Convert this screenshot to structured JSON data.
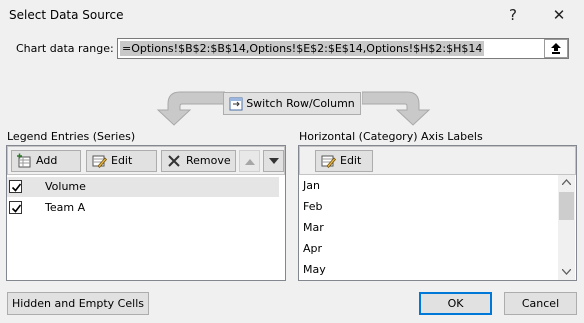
{
  "window": {
    "title": "Select Data Source",
    "help_glyph": "?",
    "close_glyph": "✕"
  },
  "range": {
    "label": "Chart data range:",
    "value": "=Options!$B$2:$B$14,Options!$E$2:$E$14,Options!$H$2:$H$14"
  },
  "switch_button": {
    "label": "Switch Row/Column"
  },
  "series_panel": {
    "heading": "Legend Entries (Series)",
    "add_label": "Add",
    "edit_label": "Edit",
    "remove_label": "Remove",
    "items": [
      {
        "label": "Volume",
        "checked": true,
        "selected": true
      },
      {
        "label": "Team A",
        "checked": true,
        "selected": false
      }
    ]
  },
  "category_panel": {
    "heading": "Horizontal (Category) Axis Labels",
    "edit_label": "Edit",
    "items": [
      "Jan",
      "Feb",
      "Mar",
      "Apr",
      "May"
    ]
  },
  "footer": {
    "hidden_empty_label": "Hidden and Empty Cells",
    "ok_label": "OK",
    "cancel_label": "Cancel"
  },
  "icons": [
    "help-icon",
    "close-icon",
    "collapse-range-icon",
    "switch-icon",
    "add-icon",
    "edit-icon",
    "remove-icon",
    "move-up-icon",
    "move-down-icon",
    "checkbox-checked-icon",
    "curved-arrow-left-icon",
    "curved-arrow-right-icon"
  ],
  "colors": {
    "selection": "#e5e5e5",
    "focus_border": "#0078d7",
    "arrow_gray": "#c8c8c8"
  }
}
